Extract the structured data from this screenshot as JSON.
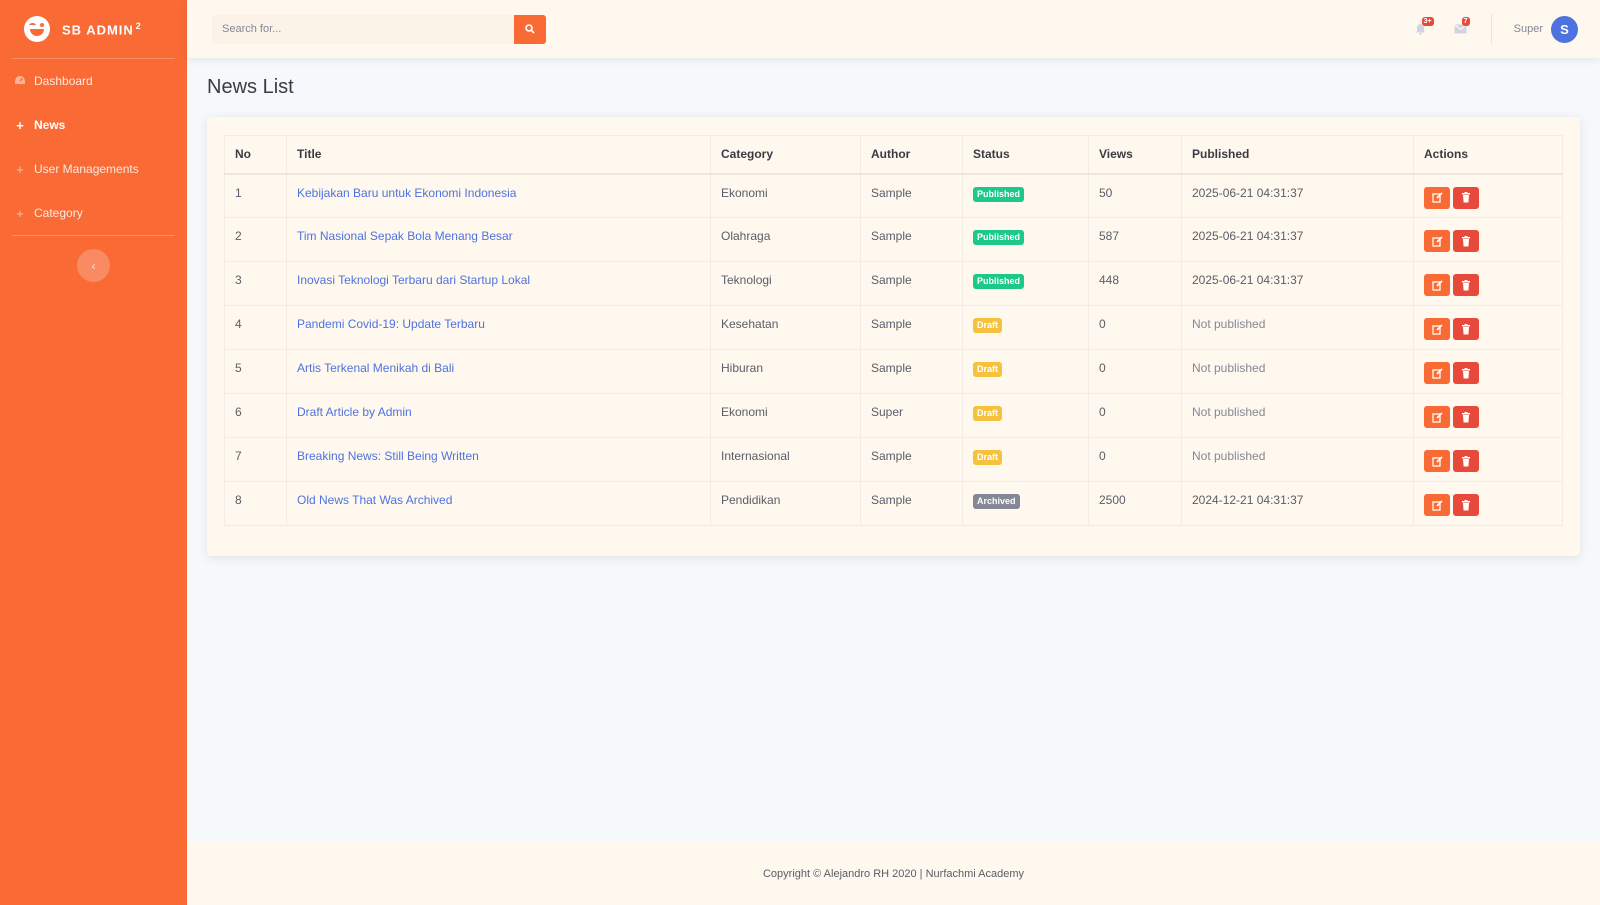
{
  "sidebar": {
    "brand": "SB ADMIN",
    "brand_sup": "2",
    "items": [
      {
        "label": "Dashboard",
        "icon": "dashboard-icon"
      },
      {
        "label": "News",
        "icon": "plus-icon"
      },
      {
        "label": "User Managements",
        "icon": "plus-icon"
      },
      {
        "label": "Category",
        "icon": "plus-icon"
      }
    ],
    "toggle_icon": "chevron-left-icon"
  },
  "topbar": {
    "search_placeholder": "Search for...",
    "alerts_count": "3+",
    "messages_count": "7",
    "user_name": "Super",
    "avatar_initial": "S"
  },
  "main": {
    "page_title": "News List",
    "columns": [
      "No",
      "Title",
      "Category",
      "Author",
      "Status",
      "Views",
      "Published",
      "Actions"
    ],
    "rows": [
      {
        "no": "1",
        "title": "Kebijakan Baru untuk Ekonomi Indonesia",
        "category": "Ekonomi",
        "author": "Sample",
        "status": "Published",
        "views": "50",
        "published": "2025-06-21 04:31:37"
      },
      {
        "no": "2",
        "title": "Tim Nasional Sepak Bola Menang Besar",
        "category": "Olahraga",
        "author": "Sample",
        "status": "Published",
        "views": "587",
        "published": "2025-06-21 04:31:37"
      },
      {
        "no": "3",
        "title": "Inovasi Teknologi Terbaru dari Startup Lokal",
        "category": "Teknologi",
        "author": "Sample",
        "status": "Published",
        "views": "448",
        "published": "2025-06-21 04:31:37"
      },
      {
        "no": "4",
        "title": "Pandemi Covid-19: Update Terbaru",
        "category": "Kesehatan",
        "author": "Sample",
        "status": "Draft",
        "views": "0",
        "published": "Not published"
      },
      {
        "no": "5",
        "title": "Artis Terkenal Menikah di Bali",
        "category": "Hiburan",
        "author": "Sample",
        "status": "Draft",
        "views": "0",
        "published": "Not published"
      },
      {
        "no": "6",
        "title": "Draft Article by Admin",
        "category": "Ekonomi",
        "author": "Super",
        "status": "Draft",
        "views": "0",
        "published": "Not published"
      },
      {
        "no": "7",
        "title": "Breaking News: Still Being Written",
        "category": "Internasional",
        "author": "Sample",
        "status": "Draft",
        "views": "0",
        "published": "Not published"
      },
      {
        "no": "8",
        "title": "Old News That Was Archived",
        "category": "Pendidikan",
        "author": "Sample",
        "status": "Archived",
        "views": "2500",
        "published": "2024-12-21 04:31:37"
      }
    ]
  },
  "footer": {
    "text": "Copyright © Alejandro RH 2020 | Nurfachmi Academy"
  },
  "colors": {
    "primary": "#f96a35",
    "published": "#1cc88a",
    "draft": "#f6c23e",
    "archived": "#858796",
    "danger": "#e74a3b",
    "link": "#4e73df"
  }
}
